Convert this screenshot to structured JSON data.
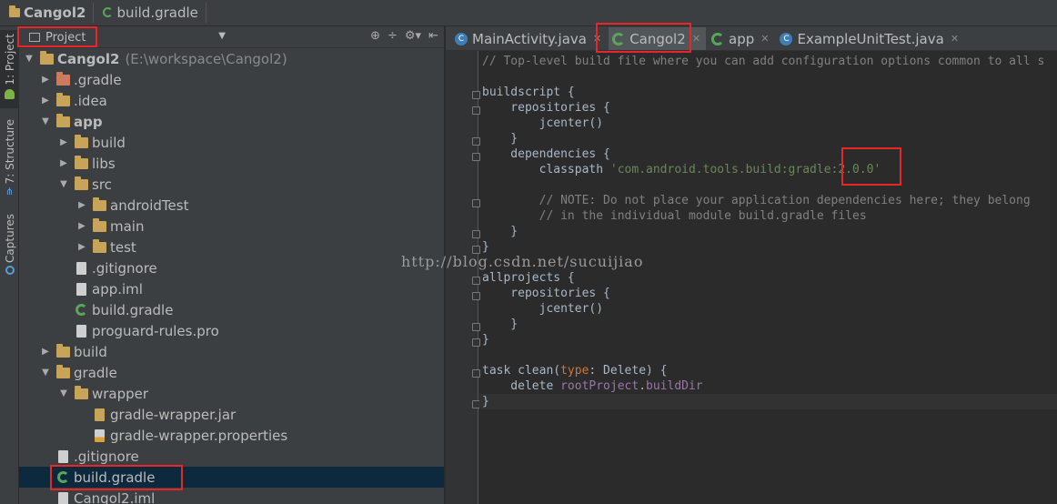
{
  "breadcrumb": [
    {
      "label": "Cangol2",
      "icon": "module-folder-icon"
    },
    {
      "label": "build.gradle",
      "icon": "gradle-icon"
    }
  ],
  "toolstrip": {
    "tabs": [
      {
        "label": "1: Project",
        "icon": "android-icon"
      },
      {
        "label": "7: Structure",
        "icon": "structure-icon"
      },
      {
        "label": "Captures",
        "icon": "capture-icon"
      }
    ]
  },
  "project_panel": {
    "view_label": "Project",
    "tree": [
      {
        "name": "Cangol2",
        "extra": "(E:\\workspace\\Cangol2)"
      },
      {
        "name": ".gradle"
      },
      {
        "name": ".idea"
      },
      {
        "name": "app"
      },
      {
        "name": "build"
      },
      {
        "name": "libs"
      },
      {
        "name": "src"
      },
      {
        "name": "androidTest"
      },
      {
        "name": "main"
      },
      {
        "name": "test"
      },
      {
        "name": ".gitignore"
      },
      {
        "name": "app.iml"
      },
      {
        "name": "build.gradle"
      },
      {
        "name": "proguard-rules.pro"
      },
      {
        "name": "build"
      },
      {
        "name": "gradle"
      },
      {
        "name": "wrapper"
      },
      {
        "name": "gradle-wrapper.jar"
      },
      {
        "name": "gradle-wrapper.properties"
      },
      {
        "name": ".gitignore"
      },
      {
        "name": "build.gradle"
      },
      {
        "name": "Cangol2.iml"
      }
    ]
  },
  "editor": {
    "tabs": [
      {
        "label": "MainActivity.java",
        "icon": "java-class-icon"
      },
      {
        "label": "Cangol2",
        "icon": "gradle-icon"
      },
      {
        "label": "app",
        "icon": "gradle-icon"
      },
      {
        "label": "ExampleUnitTest.java",
        "icon": "java-class-icon"
      }
    ],
    "code": {
      "l1": "// Top-level build file where you can add configuration options common to all s",
      "l3": "buildscript {",
      "l4": "    repositories {",
      "l5": "        jcenter()",
      "l6": "    }",
      "l7": "    dependencies {",
      "l8a": "        classpath ",
      "l8b": "'com.android.tools.build:gradle:2.0.0'",
      "l10": "        // NOTE: Do not place your application dependencies here; they belong",
      "l11": "        // in the individual module build.gradle files",
      "l12": "    }",
      "l13": "}",
      "l15": "allprojects {",
      "l16": "    repositories {",
      "l17": "        jcenter()",
      "l18": "    }",
      "l19": "}",
      "l21a": "task clean(",
      "l21b": "type",
      "l21c": ": Delete) {",
      "l22a": "    delete ",
      "l22b": "rootProject",
      "l22c": ".",
      "l22d": "buildDir",
      "l23": "}"
    }
  },
  "watermark": "http://blog.csdn.net/sucuijiao",
  "colors": {
    "highlight": "#e8262a",
    "selection": "#0d293e",
    "gradle": "#5aa55a"
  }
}
